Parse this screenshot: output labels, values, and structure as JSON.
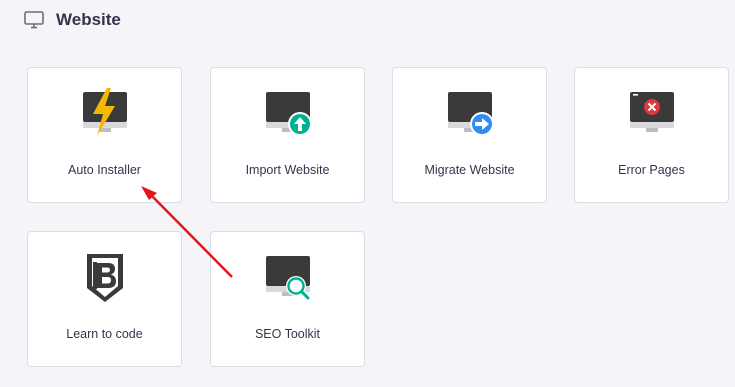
{
  "section": {
    "title": "Website",
    "icon": "monitor-icon"
  },
  "cards": [
    {
      "label": "Auto Installer",
      "icon": "auto-installer-icon"
    },
    {
      "label": "Import Website",
      "icon": "import-website-icon"
    },
    {
      "label": "Migrate Website",
      "icon": "migrate-website-icon"
    },
    {
      "label": "Error Pages",
      "icon": "error-pages-icon"
    },
    {
      "label": "Learn to code",
      "icon": "learn-to-code-icon"
    },
    {
      "label": "SEO Toolkit",
      "icon": "seo-toolkit-icon"
    }
  ],
  "colors": {
    "background": "#f4f5f9",
    "card": "#ffffff",
    "monitor": "#3a3a3a",
    "lightning": "#f5b800",
    "import_badge": "#00b090",
    "migrate_badge": "#2c8ef0",
    "error_badge": "#e0383e",
    "seo_magnifier": "#00b090",
    "annotation_arrow": "#e0181b"
  }
}
